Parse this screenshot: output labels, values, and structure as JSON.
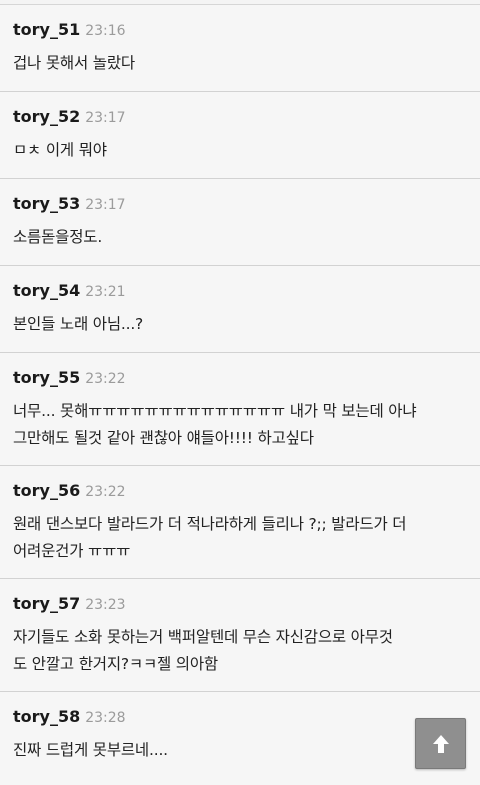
{
  "comments": [
    {
      "author": "tory_51",
      "time": "23:16",
      "text": "겁나 못해서 놀랐다"
    },
    {
      "author": "tory_52",
      "time": "23:17",
      "text": "ㅁㅊ 이게 뭐야"
    },
    {
      "author": "tory_53",
      "time": "23:17",
      "text": "소름돋을정도."
    },
    {
      "author": "tory_54",
      "time": "23:21",
      "text": "본인들 노래 아님...?"
    },
    {
      "author": "tory_55",
      "time": "23:22",
      "text": "너무... 못해ㅠㅠㅠㅠㅠㅠㅠㅠㅠㅠㅠㅠㅠㅠ 내가 막 보는데 아냐\n그만해도 될것 같아 괜찮아 얘들아!!!! 하고싶다"
    },
    {
      "author": "tory_56",
      "time": "23:22",
      "text": "원래 댄스보다 발라드가 더 적나라하게 들리나 ?;; 발라드가 더\n어려운건가 ㅠㅠㅠ"
    },
    {
      "author": "tory_57",
      "time": "23:23",
      "text": "자기들도 소화 못하는거 백퍼알텐데 무슨 자신감으로 아무것\n도 안깔고 한거지?ㅋㅋ젤 의아함"
    },
    {
      "author": "tory_58",
      "time": "23:28",
      "text": "진짜 드럽게 못부르네...."
    }
  ],
  "scroll_top_button": {
    "icon": "arrow-up-icon"
  },
  "colors": {
    "background": "#f6f6f6",
    "divider": "#d2d2d2",
    "time": "#9b9b9b",
    "button": "#8f8f8f"
  }
}
